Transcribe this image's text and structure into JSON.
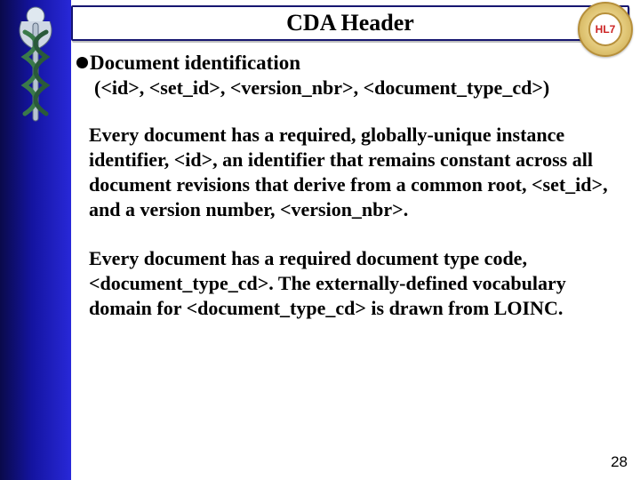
{
  "title": "CDA Header",
  "seal_label": "HL7",
  "bullet": {
    "heading": "Document identification",
    "sub": "(<id>, <set_id>, <version_nbr>, <document_type_cd>)"
  },
  "paragraphs": [
    "Every document has a required, globally-unique instance identifier, <id>, an identifier that remains constant across all document revisions that derive from a common root, <set_id>, and a version number, <version_nbr>.",
    "Every document has a required document type code, <document_type_cd>. The externally-defined vocabulary domain for <document_type_cd> is drawn from LOINC."
  ],
  "page_number": "28"
}
